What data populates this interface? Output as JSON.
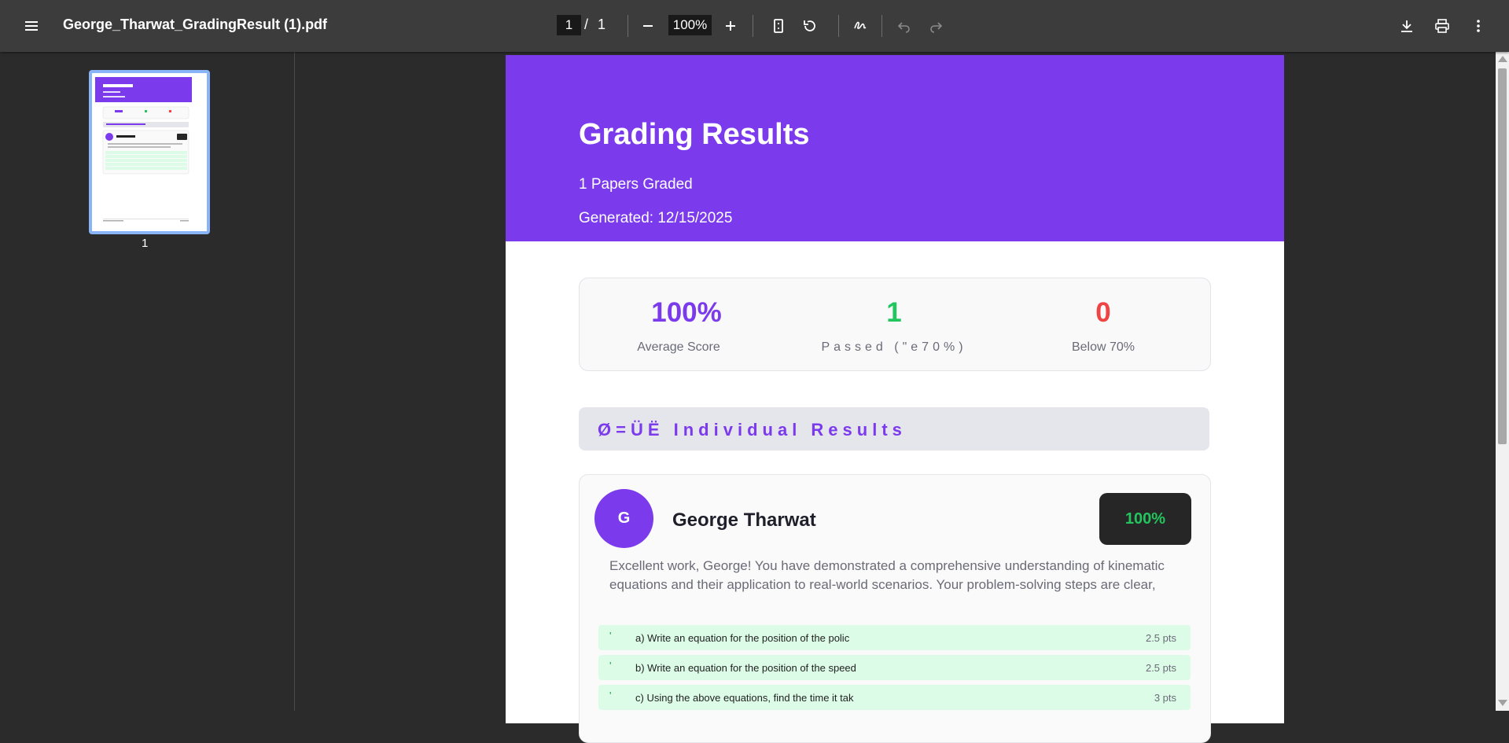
{
  "toolbar": {
    "title": "George_Tharwat_GradingResult (1).pdf",
    "page_current": "1",
    "page_separator": "/",
    "page_total": "1",
    "zoom": "100%"
  },
  "thumbnail": {
    "page_number": "1"
  },
  "document": {
    "header": {
      "title": "Grading Results",
      "papers_graded": "1 Papers Graded",
      "generated": "Generated: 12/15/2025"
    },
    "stats": [
      {
        "value": "100%",
        "label": "Average Score",
        "color": "#7c3aed"
      },
      {
        "value": "1",
        "label": "Passed (\"e70%)",
        "color": "#22c55e"
      },
      {
        "value": "0",
        "label": "Below 70%",
        "color": "#ef4444"
      }
    ],
    "section_title": "Ø=ÜË Individual Results",
    "student": {
      "initial": "G",
      "name": "George Tharwat",
      "score": "100%",
      "feedback": "Excellent work, George! You have demonstrated a comprehensive understanding of kinematic equations and their application to real-world scenarios. Your problem-solving steps are clear,",
      "questions": [
        {
          "mark": "'",
          "text": "a) Write an equation for the position of the polic",
          "points": "2.5 pts"
        },
        {
          "mark": "'",
          "text": "b) Write an equation for the position of the speed",
          "points": "2.5 pts"
        },
        {
          "mark": "'",
          "text": "c) Using the above equations, find the time it tak",
          "points": "3 pts"
        }
      ]
    }
  },
  "colors": {
    "accent": "#7c3aed",
    "toolbar": "#3c3c3c",
    "viewer_bg": "#2b2b2b",
    "pass": "#22c55e",
    "fail": "#ef4444"
  },
  "icons": [
    "menu-icon",
    "zoom-out-icon",
    "zoom-in-icon",
    "fit-page-icon",
    "rotate-icon",
    "annotate-icon",
    "undo-icon",
    "redo-icon",
    "download-icon",
    "print-icon",
    "more-icon"
  ]
}
